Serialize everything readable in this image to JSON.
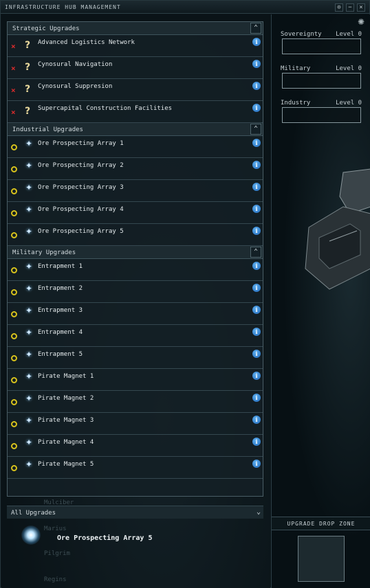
{
  "window": {
    "title": "INFRASTRUCTURE HUB MANAGEMENT",
    "buttons": [
      "⊙",
      "−",
      "×"
    ]
  },
  "sections": [
    {
      "title": "Strategic Upgrades",
      "collapse_icon": "chevron-up-icon",
      "items": [
        {
          "label": "Advanced Logistics Network",
          "status": "unavailable",
          "icon": "question-mark-icon"
        },
        {
          "label": "Cynosural Navigation",
          "status": "unavailable",
          "icon": "question-mark-icon"
        },
        {
          "label": "Cynosural Suppresion",
          "status": "unavailable",
          "icon": "question-mark-icon"
        },
        {
          "label": "Supercapital Construction Facilities",
          "status": "unavailable",
          "icon": "question-mark-icon"
        }
      ]
    },
    {
      "title": "Industrial Upgrades",
      "collapse_icon": "chevron-up-icon",
      "items": [
        {
          "label": "Ore Prospecting Array 1",
          "status": "available",
          "icon": "star-icon"
        },
        {
          "label": "Ore Prospecting Array 2",
          "status": "available",
          "icon": "star-icon"
        },
        {
          "label": "Ore Prospecting Array 3",
          "status": "available",
          "icon": "star-icon"
        },
        {
          "label": "Ore Prospecting Array 4",
          "status": "available",
          "icon": "star-icon"
        },
        {
          "label": "Ore Prospecting Array 5",
          "status": "available",
          "icon": "star-icon"
        }
      ]
    },
    {
      "title": "Military Upgrades",
      "collapse_icon": "chevron-up-icon",
      "items": [
        {
          "label": "Entrapment 1",
          "status": "available",
          "icon": "star-icon"
        },
        {
          "label": "Entrapment 2",
          "status": "available",
          "icon": "star-icon"
        },
        {
          "label": "Entrapment 3",
          "status": "available",
          "icon": "star-icon"
        },
        {
          "label": "Entrapment 4",
          "status": "available",
          "icon": "star-icon"
        },
        {
          "label": "Entrapment 5",
          "status": "available",
          "icon": "star-icon"
        },
        {
          "label": "Pirate Magnet 1",
          "status": "available",
          "icon": "star-icon"
        },
        {
          "label": "Pirate Magnet 2",
          "status": "available",
          "icon": "star-icon"
        },
        {
          "label": "Pirate Magnet 3",
          "status": "available",
          "icon": "star-icon"
        },
        {
          "label": "Pirate Magnet 4",
          "status": "available",
          "icon": "star-icon"
        },
        {
          "label": "Pirate Magnet 5",
          "status": "available",
          "icon": "star-icon"
        }
      ]
    }
  ],
  "all_upgrades": {
    "title": "All Upgrades",
    "selected": "Ore Prospecting Array 5"
  },
  "background_ghost_text": [
    "Mulciber",
    "Marius",
    "Pilgrim",
    "Regins"
  ],
  "indices": [
    {
      "name": "Sovereignty",
      "level": "Level 0"
    },
    {
      "name": "Military",
      "level": "Level 0"
    },
    {
      "name": "Industry",
      "level": "Level 0"
    }
  ],
  "drop_zone": {
    "title": "UPGRADE DROP ZONE"
  },
  "colors": {
    "unavailable": "#d92c2c",
    "available": "#d8c21c",
    "info": "#1e66b8"
  }
}
